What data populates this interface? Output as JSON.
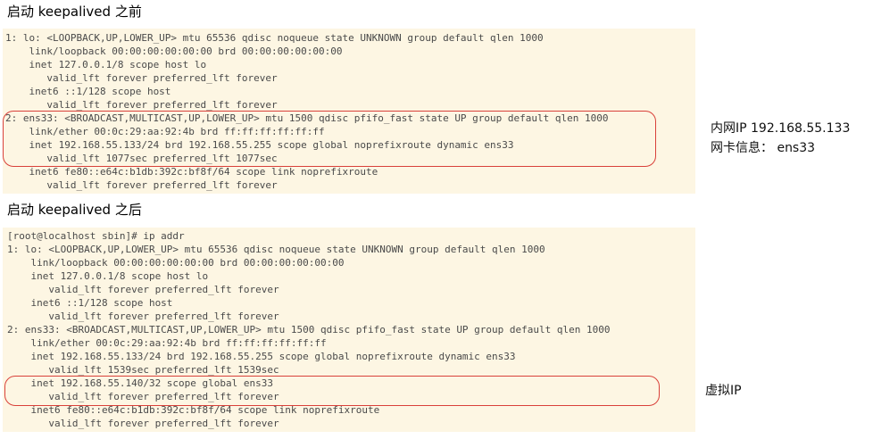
{
  "before": {
    "heading": "启动 keepalived 之前",
    "lines": [
      "1: lo: <LOOPBACK,UP,LOWER_UP> mtu 65536 qdisc noqueue state UNKNOWN group default qlen 1000",
      "    link/loopback 00:00:00:00:00:00 brd 00:00:00:00:00:00",
      "    inet 127.0.0.1/8 scope host lo",
      "       valid_lft forever preferred_lft forever",
      "    inet6 ::1/128 scope host",
      "       valid_lft forever preferred_lft forever",
      "2: ens33: <BROADCAST,MULTICAST,UP,LOWER_UP> mtu 1500 qdisc pfifo_fast state UP group default qlen 1000",
      "    link/ether 00:0c:29:aa:92:4b brd ff:ff:ff:ff:ff:ff",
      "    inet 192.168.55.133/24 brd 192.168.55.255 scope global noprefixroute dynamic ens33",
      "       valid_lft 1077sec preferred_lft 1077sec",
      "    inet6 fe80::e64c:b1db:392c:bf8f/64 scope link noprefixroute",
      "       valid_lft forever preferred_lft forever"
    ],
    "annotation_line1": "内网IP 192.168.55.133",
    "annotation_line2": "网卡信息：  ens33"
  },
  "after": {
    "heading": "启动 keepalived 之后",
    "lines": [
      "[root@localhost sbin]# ip addr",
      "1: lo: <LOOPBACK,UP,LOWER_UP> mtu 65536 qdisc noqueue state UNKNOWN group default qlen 1000",
      "    link/loopback 00:00:00:00:00:00 brd 00:00:00:00:00:00",
      "    inet 127.0.0.1/8 scope host lo",
      "       valid_lft forever preferred_lft forever",
      "    inet6 ::1/128 scope host",
      "       valid_lft forever preferred_lft forever",
      "2: ens33: <BROADCAST,MULTICAST,UP,LOWER_UP> mtu 1500 qdisc pfifo_fast state UP group default qlen 1000",
      "    link/ether 00:0c:29:aa:92:4b brd ff:ff:ff:ff:ff:ff",
      "    inet 192.168.55.133/24 brd 192.168.55.255 scope global noprefixroute dynamic ens33",
      "       valid_lft 1539sec preferred_lft 1539sec",
      "    inet 192.168.55.140/32 scope global ens33",
      "       valid_lft forever preferred_lft forever",
      "    inet6 fe80::e64c:b1db:392c:bf8f/64 scope link noprefixroute",
      "       valid_lft forever preferred_lft forever"
    ],
    "annotation": "虚拟IP"
  },
  "colors": {
    "terminal_bg": "#fdf6e3",
    "terminal_text": "#4a4a4a",
    "highlight_border": "#d9413a"
  }
}
